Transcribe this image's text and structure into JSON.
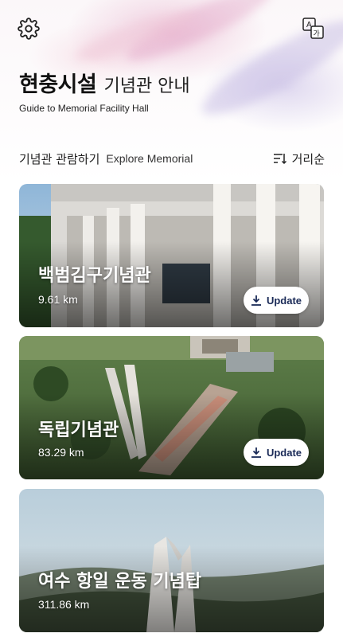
{
  "header": {
    "title_main": "현충시설",
    "title_sub": "기념관 안내",
    "title_en": "Guide to Memorial Facility Hall",
    "settings_icon": "gear-icon",
    "language_icon": "translate-icon",
    "language_icon_letters": [
      "A",
      "가"
    ]
  },
  "section": {
    "title_ko": "기념관 관람하기",
    "title_en": "Explore Memorial",
    "sort_label": "거리순",
    "sort_icon": "sort-icon"
  },
  "memorials": [
    {
      "name": "백범김구기념관",
      "distance": "9.61 km",
      "update_label": "Update",
      "has_update": true
    },
    {
      "name": "독립기념관",
      "distance": "83.29 km",
      "update_label": "Update",
      "has_update": true
    },
    {
      "name": "여수 항일 운동 기념탑",
      "distance": "311.86 km",
      "has_update": false
    }
  ],
  "colors": {
    "accent": "#1a2a57",
    "text": "#111111",
    "card_text": "#ffffff"
  }
}
